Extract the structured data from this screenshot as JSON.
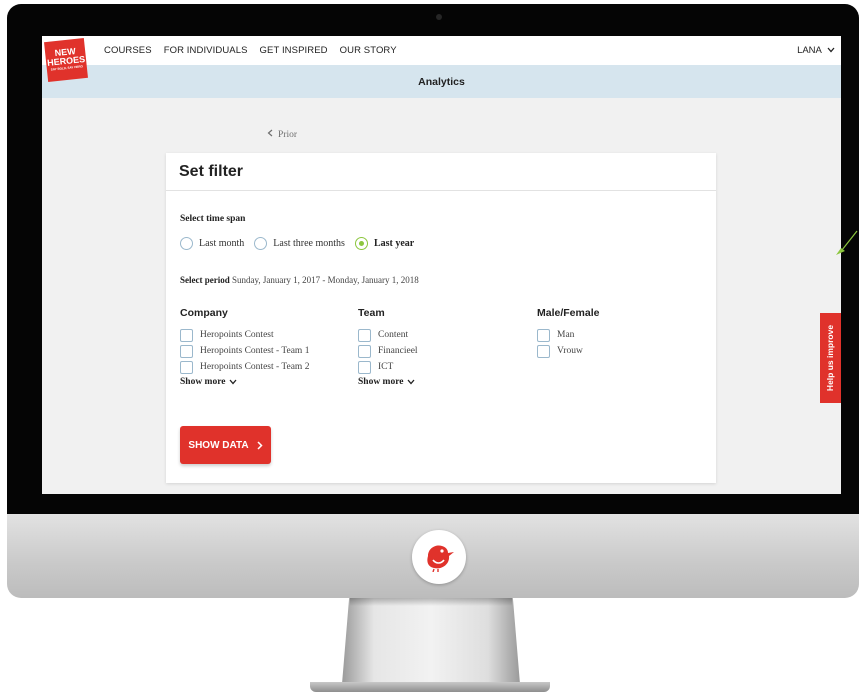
{
  "nav": {
    "brand": {
      "line1": "NEW",
      "line2": "HEROES",
      "tagline": "SAY BOLD, SAY HERO"
    },
    "links": [
      "COURSES",
      "FOR INDIVIDUALS",
      "GET INSPIRED",
      "OUR STORY"
    ],
    "user": "LANA"
  },
  "subbar": {
    "title": "Analytics"
  },
  "prior": {
    "label": "Prior"
  },
  "filter": {
    "title": "Set filter",
    "time_span_label": "Select time span",
    "time_spans": [
      {
        "label": "Last month",
        "selected": false
      },
      {
        "label": "Last three months",
        "selected": false
      },
      {
        "label": "Last year",
        "selected": true
      }
    ],
    "period_label": "Select period",
    "period_value": "Sunday, January 1, 2017 - Monday, January 1, 2018",
    "columns": [
      {
        "title": "Company",
        "items": [
          "Heropoints Contest",
          "Heropoints Contest - Team 1",
          "Heropoints Contest - Team 2"
        ],
        "show_more": "Show more"
      },
      {
        "title": "Team",
        "items": [
          "Content",
          "Financieel",
          "ICT"
        ],
        "show_more": "Show more"
      },
      {
        "title": "Male/Female",
        "items": [
          "Man",
          "Vrouw"
        ]
      }
    ],
    "submit": "SHOW DATA"
  },
  "help_tab": {
    "label": "Help us improve"
  },
  "colors": {
    "brand_red": "#e0322b",
    "accent_green": "#8cc63e",
    "subbar_blue": "#d6e5ee"
  },
  "icons": [
    "chevron-left-icon",
    "chevron-down-icon",
    "chevron-right-icon",
    "bird-logo-icon"
  ]
}
